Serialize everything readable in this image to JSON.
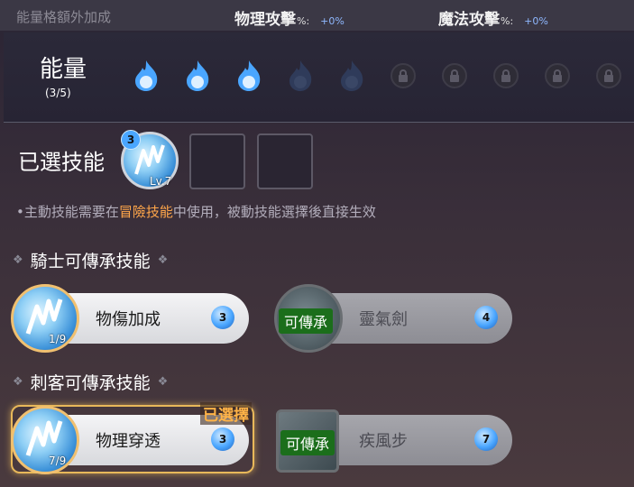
{
  "top_bar": {
    "label": "能量格額外加成",
    "physical": {
      "name": "物理攻擊",
      "pct": "%:",
      "value": "+0%"
    },
    "magic": {
      "name": "魔法攻擊",
      "pct": "%:",
      "value": "+0%"
    }
  },
  "energy": {
    "title": "能量",
    "count": "(3/5)",
    "slots": [
      "filled",
      "filled",
      "filled",
      "empty",
      "empty",
      "locked",
      "locked",
      "locked",
      "locked",
      "locked"
    ]
  },
  "selected": {
    "title": "已選技能",
    "skill_cost": "3",
    "skill_level": "Lv.7",
    "note_prefix": "•主動技能需要在",
    "note_highlight": "冒險技能",
    "note_suffix": "中使用，被動技能選擇後直接生效"
  },
  "knight": {
    "title": "騎士可傳承技能",
    "skills": [
      {
        "name": "物傷加成",
        "count": "1/9",
        "cost": "3",
        "state": "available"
      },
      {
        "name": "靈氣劍",
        "inherit_label": "可傳承",
        "cost": "4",
        "state": "inheritable"
      }
    ]
  },
  "assassin": {
    "title": "刺客可傳承技能",
    "selected_label": "已選擇",
    "skills": [
      {
        "name": "物理穿透",
        "count": "7/9",
        "cost": "3",
        "state": "selected"
      },
      {
        "name": "疾風步",
        "inherit_label": "可傳承",
        "cost": "7",
        "state": "inheritable"
      }
    ]
  },
  "colors": {
    "highlight": "#ffa64a",
    "energy_blue": "#4aa6ff",
    "selected_gold": "#e8b85a",
    "inherit_green": "#1b6e1b"
  }
}
